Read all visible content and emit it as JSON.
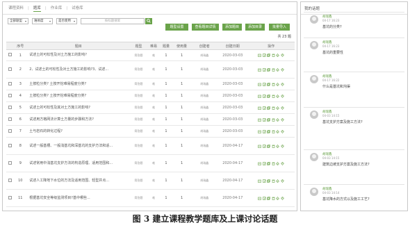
{
  "tabs": [
    "课程资料",
    "题库",
    "作业库",
    "试卷库"
  ],
  "active_tab": 1,
  "filters": {
    "select1": "全部题型",
    "select2": "难易度",
    "select3": "是否使用",
    "search_placeholder": "按标题搜索"
  },
  "actions": [
    "题型设置",
    "查看题目详情",
    "添加题目",
    "添加目录",
    "批量导入"
  ],
  "count": "共 23 题",
  "columns": [
    "序号",
    "题目",
    "题型",
    "难易",
    "题量",
    "使用量",
    "创建者",
    "创建日期",
    "操作"
  ],
  "rows": [
    {
      "no": "1",
      "title": "试述土的可松性及对土方施工的影响?",
      "type": "简答题",
      "diff": "难",
      "qty": "1",
      "used": "1",
      "creator": "胡瑞鑫",
      "date": "2020-03-03"
    },
    {
      "no": "2",
      "title": "2、试述土的可松性及对土方施工的影响?3、试述...",
      "type": "简答题",
      "diff": "难",
      "qty": "1",
      "used": "1",
      "creator": "胡瑞鑫",
      "date": "2020-03-03"
    },
    {
      "no": "3",
      "title": "土按粒分类? 土按开挖难易程度分类?",
      "type": "简答题",
      "diff": "难",
      "qty": "1",
      "used": "1",
      "creator": "胡瑞鑫",
      "date": "2020-03-03"
    },
    {
      "no": "4",
      "title": "土按粒分类? 土按开挖难易程度分类?",
      "type": "简答题",
      "diff": "难",
      "qty": "1",
      "used": "1",
      "creator": "胡瑞鑫",
      "date": "2020-03-03"
    },
    {
      "no": "5",
      "title": "试述土的可松性及其对土方施工的影响?",
      "type": "简答题",
      "diff": "难",
      "qty": "1",
      "used": "1",
      "creator": "胡瑞鑫",
      "date": "2020-03-03"
    },
    {
      "no": "6",
      "title": "试述用方格网法计算土方量的步骤和方法?",
      "type": "简答题",
      "diff": "难",
      "qty": "1",
      "used": "1",
      "creator": "胡瑞鑫",
      "date": "2020-03-03"
    },
    {
      "no": "7",
      "title": "土与岩石的转化过程?",
      "type": "简答题",
      "diff": "难",
      "qty": "1",
      "used": "1",
      "creator": "胡瑞鑫",
      "date": "2020-03-03"
    },
    {
      "no": "8",
      "title": "试述一般基槽、一般浅基坑和深基坑的支护方法和适...",
      "type": "简答题",
      "diff": "难",
      "qty": "1",
      "used": "1",
      "creator": "胡瑞鑫",
      "date": "2020-04-17"
    },
    {
      "no": "9",
      "title": "试述常用中浅基坑支护方法的构造原理、适用范围和...",
      "type": "简答题",
      "diff": "难",
      "qty": "1",
      "used": "1",
      "creator": "胡瑞鑫",
      "date": "2020-04-17"
    },
    {
      "no": "10",
      "title": "试述人工降地下水位的方法及适用范围、轻型井点...",
      "type": "简答题",
      "diff": "难",
      "qty": "1",
      "used": "1",
      "creator": "胡瑞鑫",
      "date": "2020-04-17"
    },
    {
      "no": "11",
      "title": "根据基坑安全等级监测项目?基中哪些...",
      "type": "简答题",
      "diff": "难",
      "qty": "1",
      "used": "1",
      "creator": "胡瑞鑫",
      "date": "2020-04-17"
    }
  ],
  "side": {
    "title": "我的话题",
    "topics": [
      {
        "user": "胡瑞鑫",
        "time": "04-17 16:23",
        "title": "基坑的分类?"
      },
      {
        "user": "胡瑞鑫",
        "time": "04-17 16:23",
        "title": "基坑的重要性"
      },
      {
        "user": "胡瑞鑫",
        "time": "04-17 16:22",
        "title": "什么是基坑和沟渠"
      },
      {
        "user": "胡瑞鑫",
        "time": "04-03 14:15",
        "title": "基坑支护方案及施工方法?"
      },
      {
        "user": "胡瑞鑫",
        "time": "04-03 14:15",
        "title": "建筑边坡支护方案及施工方法?"
      },
      {
        "user": "胡瑞鑫",
        "time": "04-03 14:14",
        "title": "基坑降水的方式以及施工工艺?"
      }
    ]
  },
  "caption": "图 3  建立课程教学题库及上课讨论话题",
  "colors": {
    "accent": "#6aa34a",
    "icon": "#6aa34a"
  }
}
